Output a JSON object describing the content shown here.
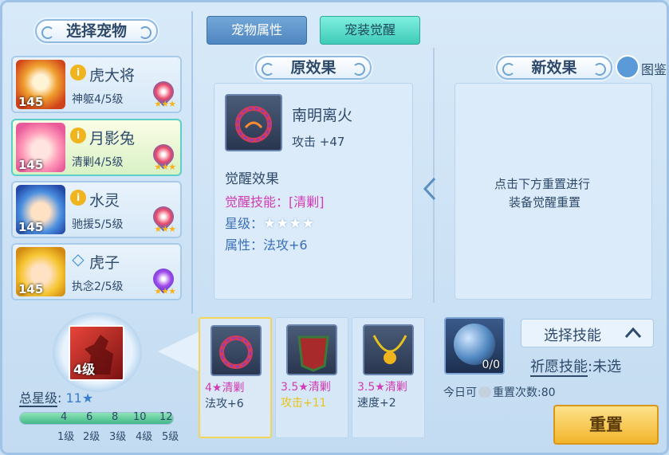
{
  "left": {
    "title": "选择宠物",
    "pets": [
      {
        "name": "虎大将",
        "badge": "i",
        "level": "145",
        "sub": "神躯4/5级",
        "stars": "★★★"
      },
      {
        "name": "月影兔",
        "badge": "i",
        "level": "145",
        "sub": "清剿4/5级",
        "stars": "★★★"
      },
      {
        "name": "水灵",
        "badge": "i",
        "level": "145",
        "sub": "驰援5/5级",
        "stars": "★★★"
      },
      {
        "name": "虎子",
        "badge": "◇",
        "level": "145",
        "sub": "执念2/5级",
        "stars": "★★★"
      }
    ],
    "skill_level": "4级",
    "total_star_label": "总星级",
    "total_star_value": "11",
    "star_glyph": "★",
    "progress": {
      "fraction": 0.04,
      "ticks": [
        "4",
        "6",
        "8",
        "10",
        "12"
      ],
      "levels": [
        "1级",
        "2级",
        "3级",
        "4级",
        "5级"
      ]
    }
  },
  "tabs": {
    "attr": "宠物属性",
    "awaken": "宠装觉醒"
  },
  "original": {
    "title": "原效果",
    "item_name": "南明离火",
    "item_stat": "攻击 +47",
    "awaken_title": "觉醒效果",
    "skill_label": "觉醒技能：",
    "skill_value": "[清剿]",
    "star_label": "星级：",
    "star_value": "★★★★",
    "attr_label": "属性：",
    "attr_value": "法攻+6"
  },
  "new_effect": {
    "title": "新效果",
    "atlas_label": "图鉴",
    "hint_line1": "点击下方重置进行",
    "hint_line2": "装备觉醒重置"
  },
  "items": [
    {
      "line1": "4★清剿",
      "line2": "法攻+6",
      "highlight": false
    },
    {
      "line1": "3.5★清剿",
      "line2": "攻击+11",
      "highlight": true
    },
    {
      "line1": "3.5★清剿",
      "line2": "速度+2",
      "highlight": false
    }
  ],
  "bottom": {
    "orb_count": "0/0",
    "today_label": "今日可",
    "reset_count_label": "重置次数",
    "reset_count_value": ":80",
    "select_skill": "选择技能",
    "wish_label": "祈愿技能",
    "wish_value": ":未选",
    "reset_button": "重置"
  },
  "colors": {
    "accent": "#5ad0c8",
    "pink": "#d03cb5",
    "yellow": "#e8c31b",
    "button": "#f5c53a"
  }
}
